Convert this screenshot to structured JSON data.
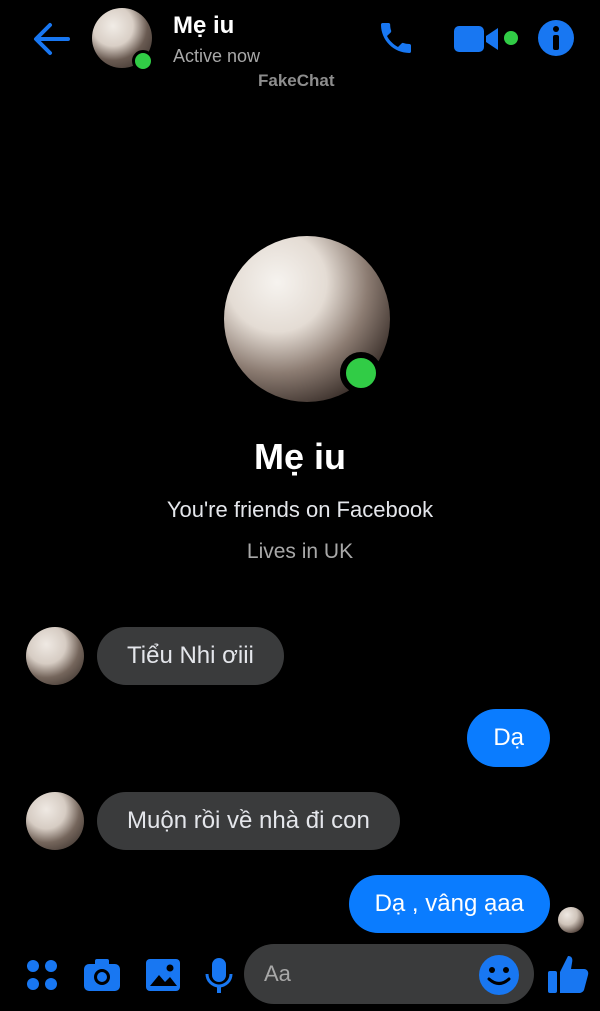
{
  "header": {
    "contact_name": "Mẹ iu",
    "status": "Active now",
    "watermark": "FakeChat"
  },
  "profile": {
    "name": "Mẹ iu",
    "friends_line": "You're friends on Facebook",
    "location_line": "Lives in UK"
  },
  "messages": [
    {
      "direction": "incoming",
      "text": "Tiểu Nhi ơiii"
    },
    {
      "direction": "outgoing",
      "text": "Dạ"
    },
    {
      "direction": "incoming",
      "text": "Muộn rồi về nhà đi con"
    },
    {
      "direction": "outgoing",
      "text": "Dạ , vâng ạaa"
    }
  ],
  "composer": {
    "placeholder": "Aa"
  },
  "colors": {
    "accent": "#1877f2",
    "outgoing_bubble": "#0a7cff",
    "incoming_bubble": "#3a3b3c",
    "online": "#31cc46",
    "background": "#000000"
  },
  "icons": [
    "back-arrow-icon",
    "phone-icon",
    "video-camera-icon",
    "info-icon",
    "apps-grid-icon",
    "camera-icon",
    "image-icon",
    "microphone-icon",
    "emoji-icon",
    "thumbs-up-icon"
  ]
}
